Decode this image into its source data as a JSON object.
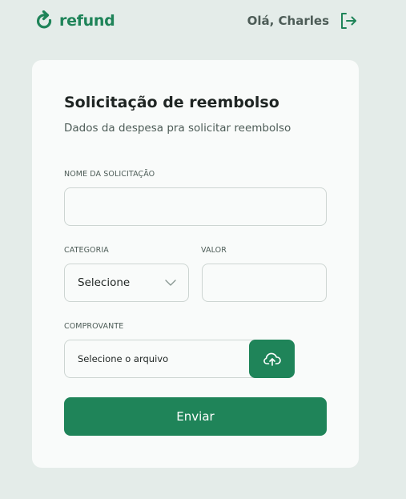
{
  "header": {
    "logo_text": "refund",
    "greeting": "Olá, Charles"
  },
  "form": {
    "title": "Solicitação de reembolso",
    "subtitle": "Dados da despesa pra solicitar reembolso",
    "name_field": {
      "label": "NOME DA SOLICITAÇÃO",
      "value": ""
    },
    "category_field": {
      "label": "CATEGORIA",
      "selected": "Selecione"
    },
    "amount_field": {
      "label": "VALOR",
      "value": ""
    },
    "receipt_field": {
      "label": "COMPROVANTE",
      "file_text": "Selecione o arquivo"
    },
    "submit_label": "Enviar"
  },
  "colors": {
    "brand": "#1f8459",
    "background": "#e4ece9",
    "card": "#f9fbfa",
    "text_muted": "#4d5c57"
  },
  "icons": {
    "logo": "refresh-arrow-icon",
    "logout": "sign-out-icon",
    "select": "chevron-down-icon",
    "upload": "cloud-upload-icon"
  }
}
